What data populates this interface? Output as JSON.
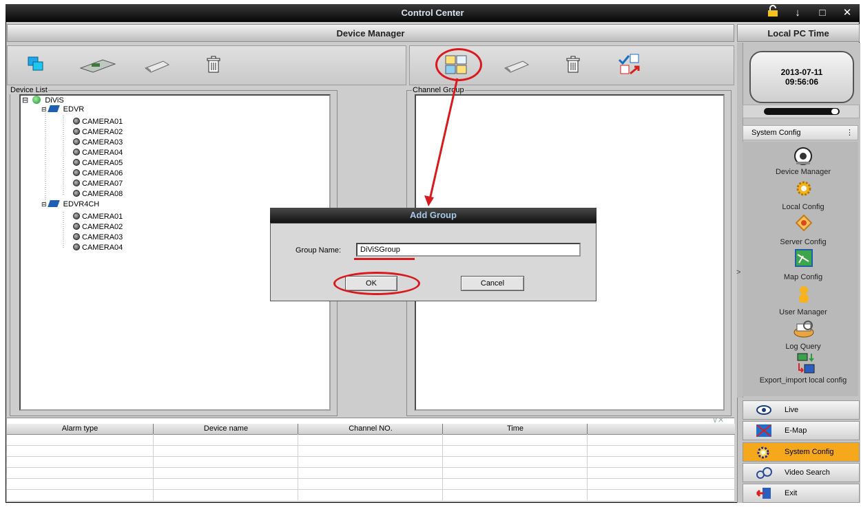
{
  "window": {
    "title": "Control Center",
    "controls": [
      "↓",
      "□",
      "✕"
    ]
  },
  "header": {
    "device_manager": "Device Manager",
    "local_time_title": "Local PC Time"
  },
  "clock": {
    "date": "2013-07-11",
    "time": "09:56:06"
  },
  "device_list": {
    "label": "Device List",
    "root": "DiViS",
    "devices": [
      {
        "name": "EDVR",
        "cameras": [
          "CAMERA01",
          "CAMERA02",
          "CAMERA03",
          "CAMERA04",
          "CAMERA05",
          "CAMERA06",
          "CAMERA07",
          "CAMERA08"
        ]
      },
      {
        "name": "EDVR4CH",
        "cameras": [
          "CAMERA01",
          "CAMERA02",
          "CAMERA03",
          "CAMERA04"
        ]
      }
    ]
  },
  "channel_group": {
    "label": "Channel Group"
  },
  "dialog": {
    "title": "Add Group",
    "field_label": "Group Name:",
    "field_value": "DiViSGroup",
    "ok": "OK",
    "cancel": "Cancel"
  },
  "alarm_table": {
    "columns": [
      "Alarm type",
      "Device name",
      "Channel NO.",
      "Time",
      ""
    ],
    "close_glyphs": "∨✕"
  },
  "sidebar": {
    "section": "System Config",
    "items": [
      {
        "label": "Device Manager",
        "icon": "webcam-icon"
      },
      {
        "label": "Local Config",
        "icon": "gear-icon"
      },
      {
        "label": "Server Config",
        "icon": "server-icon"
      },
      {
        "label": "Map Config",
        "icon": "map-icon"
      },
      {
        "label": "User Manager",
        "icon": "user-icon"
      },
      {
        "label": "Log Query",
        "icon": "log-icon"
      },
      {
        "label": "Export_import local config",
        "icon": "export-import-icon"
      }
    ],
    "nav": [
      {
        "label": "Live",
        "icon": "eye-icon"
      },
      {
        "label": "E-Map",
        "icon": "emap-icon"
      },
      {
        "label": "System Config",
        "icon": "gear-icon"
      },
      {
        "label": "Video Search",
        "icon": "video-search-icon"
      },
      {
        "label": "Exit",
        "icon": "exit-icon"
      }
    ],
    "expand_glyph": ">",
    "section_glyph": "⋮"
  },
  "colors": {
    "annotation_red": "#d8191d",
    "selected_nav": "#f6a81c",
    "titlebar": "#111111"
  }
}
